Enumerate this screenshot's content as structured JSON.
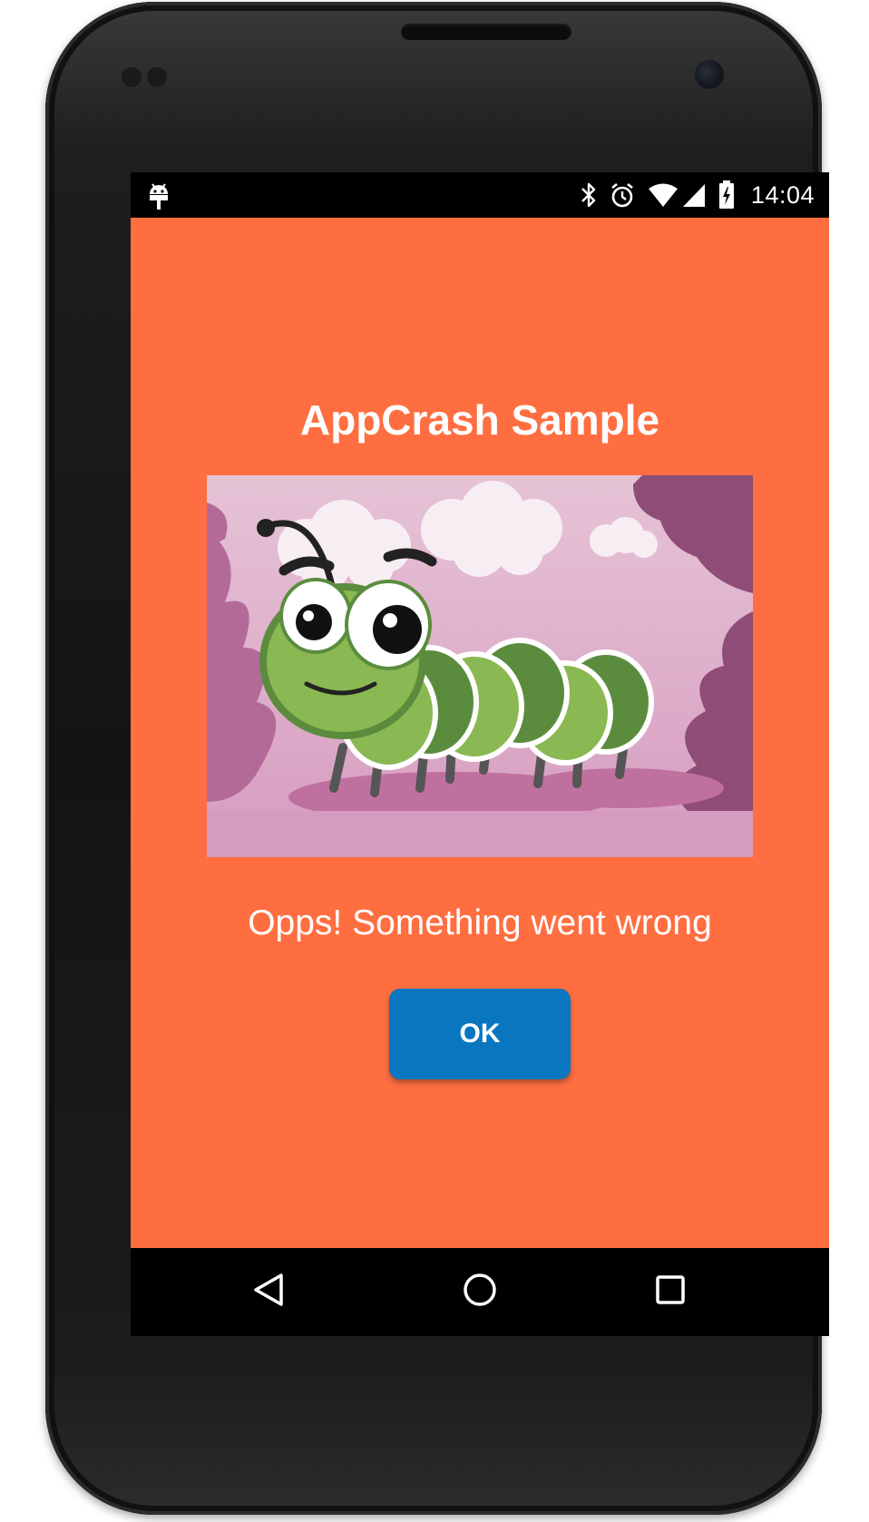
{
  "status_bar": {
    "time": "14:04",
    "icons": [
      "android-debug-icon",
      "bluetooth-icon",
      "alarm-icon",
      "wifi-icon",
      "cell-signal-icon",
      "battery-charging-icon"
    ]
  },
  "app": {
    "title": "AppCrash Sample",
    "message": "Opps! Something went wrong",
    "ok_label": "OK",
    "background_color": "#ff6e40",
    "button_color": "#0a76bf"
  },
  "illustration": {
    "subject": "cartoon caterpillar"
  },
  "navigation_bar": {
    "buttons": [
      "back-icon",
      "home-icon",
      "recents-icon"
    ]
  }
}
